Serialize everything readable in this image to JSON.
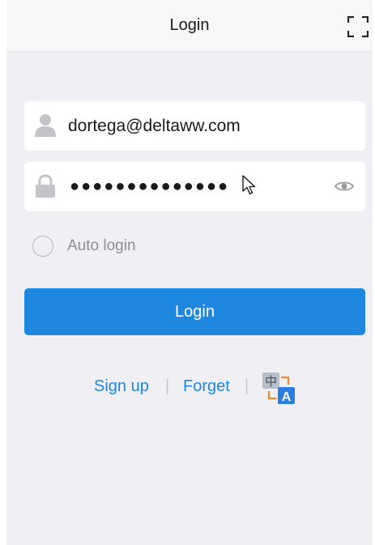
{
  "header": {
    "title": "Login",
    "scan_icon": "scan-icon"
  },
  "form": {
    "username": {
      "value": "dortega@deltaww.com",
      "icon": "user-icon"
    },
    "password": {
      "masked_value": "●●●●●●●●●●●●●●",
      "icon": "lock-icon",
      "toggle_icon": "eye-icon"
    },
    "auto_login": {
      "label": "Auto login",
      "checked": false
    },
    "login_button_label": "Login"
  },
  "links": {
    "sign_up": "Sign up",
    "separator": "|",
    "forget": "Forget",
    "language_icon": "language-switch-icon",
    "language_glyphs": [
      "中",
      "A"
    ]
  },
  "colors": {
    "accent": "#1e87e0",
    "background": "#efeff4",
    "header": "#f7f7f7"
  }
}
